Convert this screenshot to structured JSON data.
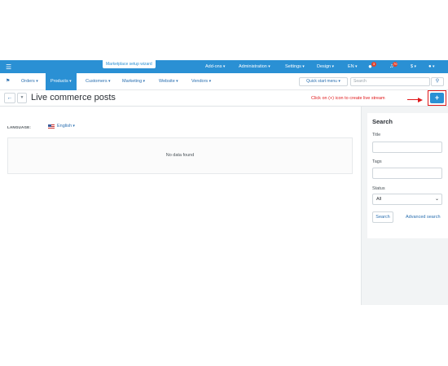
{
  "topbar": {
    "menu_icon": "hamburger-icon",
    "wizard_label": "Marketplace setup wizard",
    "menus": [
      "Add-ons",
      "Administration",
      "Settings",
      "Design",
      "EN"
    ],
    "badges": [
      "3",
      "70"
    ],
    "currency": "$",
    "accent": "#2a90d4"
  },
  "nav": {
    "home_icon": "home-icon",
    "items": [
      "Orders",
      "Products",
      "Customers",
      "Marketing",
      "Website",
      "Vendors"
    ],
    "active": "Products",
    "quick_start": "Quick start menu",
    "search_placeholder": "Search",
    "search_icon": "search-icon"
  },
  "page": {
    "back_icon": "arrow-left-icon",
    "title": "Live commerce posts",
    "instruction": "Click on (+) icon to create live stream",
    "add_label": "+",
    "instruction_color": "#e0191b"
  },
  "content": {
    "language_label": "LANGUAGE:",
    "language_value": "English",
    "empty_message": "No data found"
  },
  "sidebar": {
    "heading": "Search",
    "title_label": "Title",
    "title_value": "",
    "tags_label": "Tags",
    "tags_value": "",
    "status_label": "Status",
    "status_value": "All",
    "search_button": "Search",
    "advanced_link": "Advanced search"
  }
}
